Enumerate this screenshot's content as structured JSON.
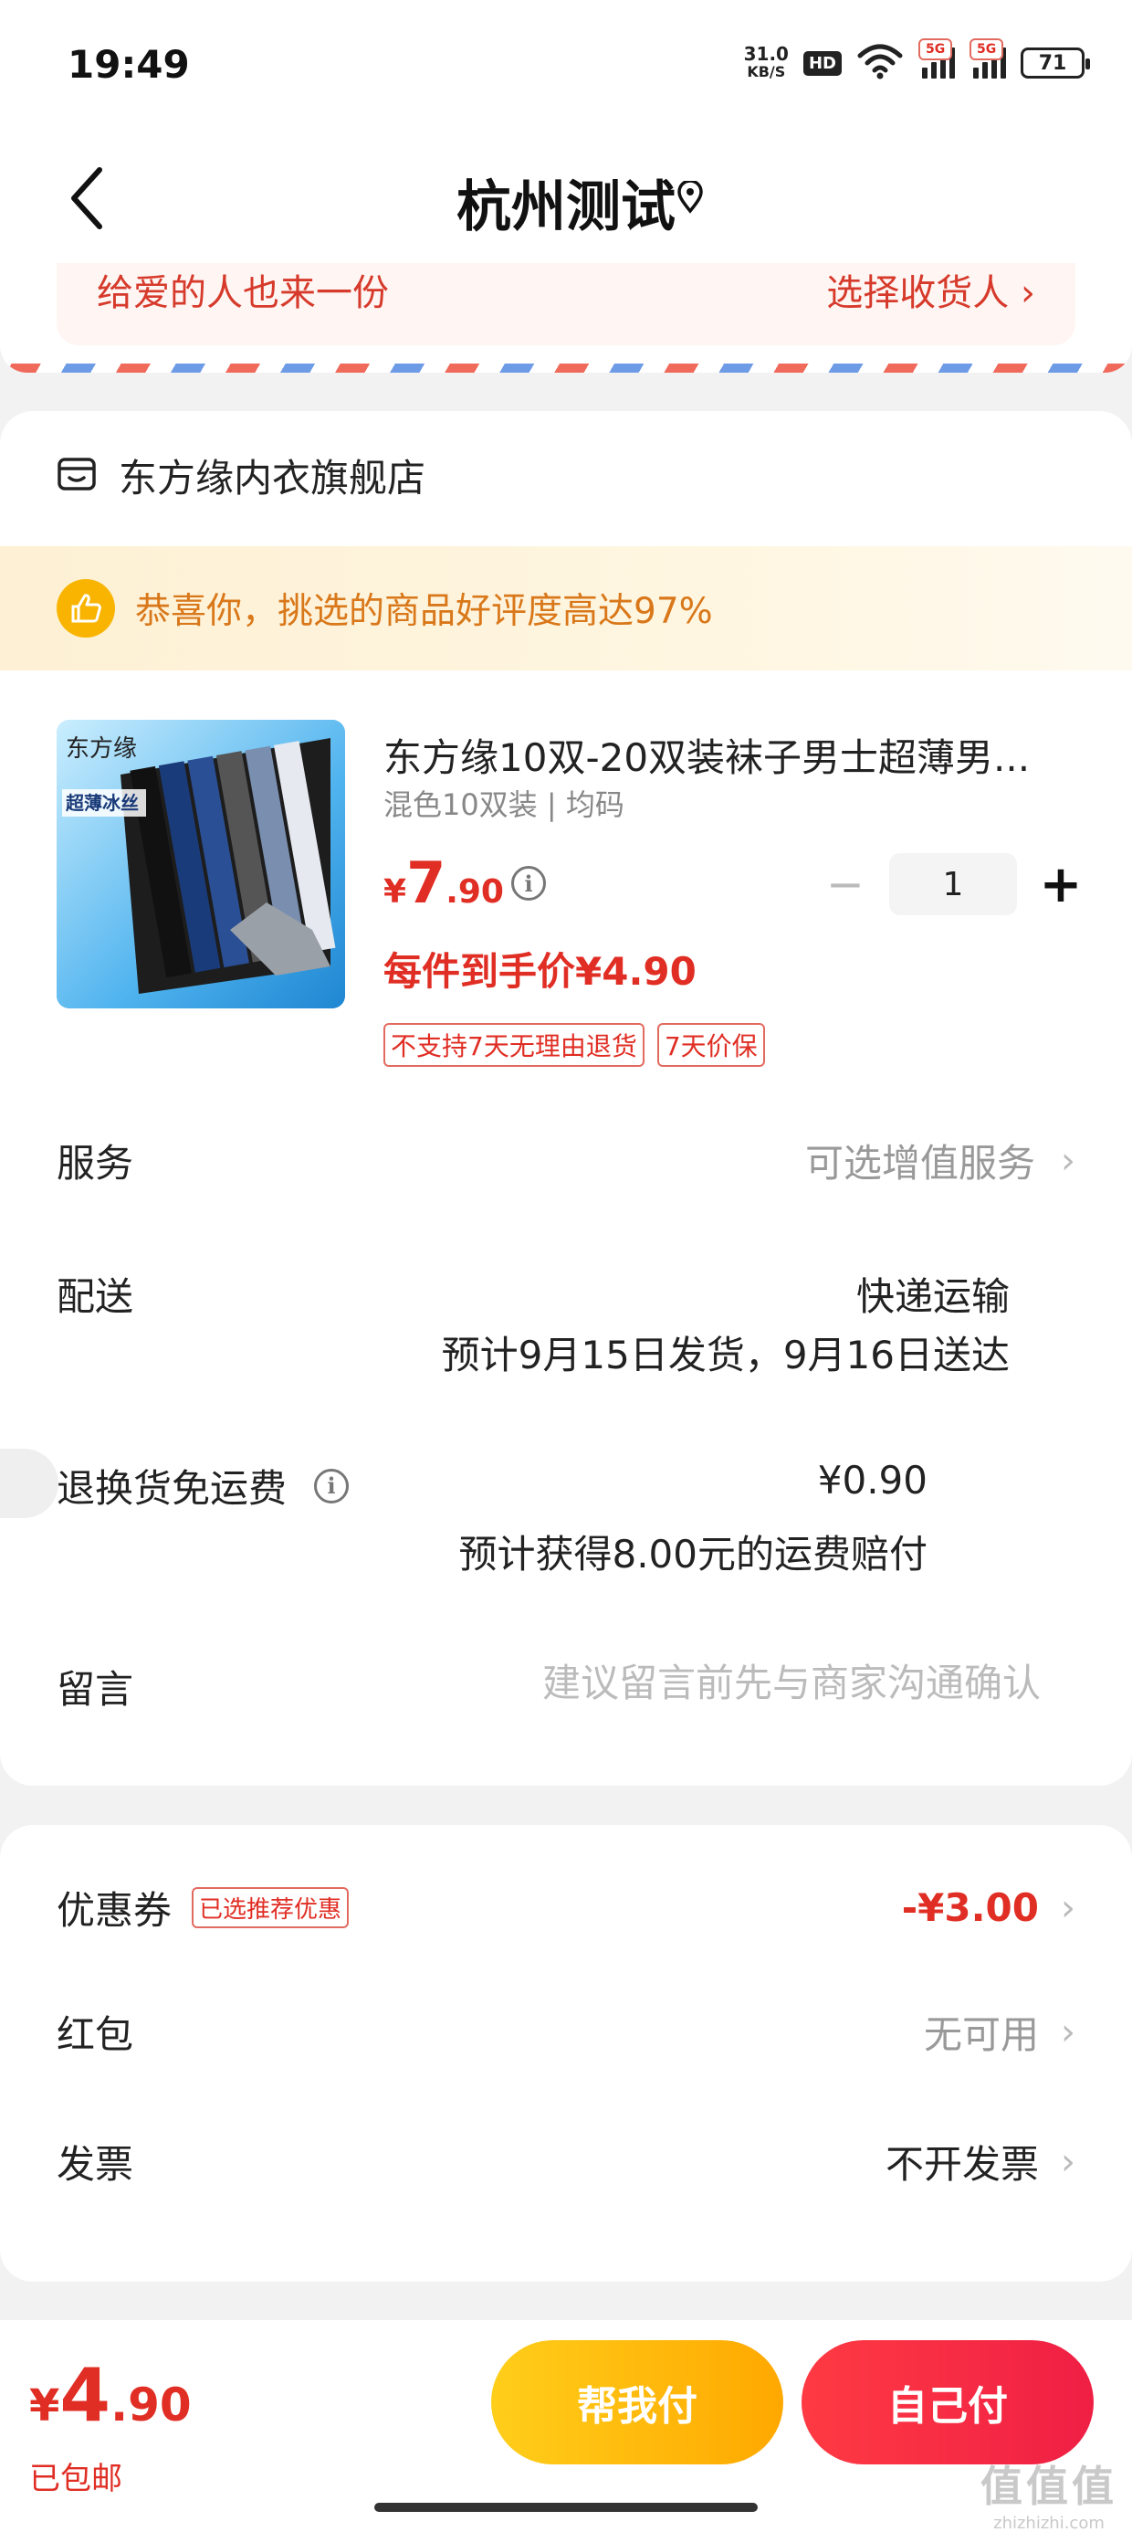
{
  "status_bar": {
    "time": "19:49",
    "net_speed": "31.0",
    "net_unit": "KB/S",
    "hd": "HD",
    "sig1": "5G",
    "sig2": "5G",
    "battery": "71"
  },
  "header": {
    "title": "杭州测试"
  },
  "address": {
    "left_text": "给爱的人也来一份",
    "right_text": "选择收货人 ›"
  },
  "store": {
    "name": "东方缘内衣旗舰店"
  },
  "praise": {
    "text": "恭喜你，挑选的商品好评度高达97%"
  },
  "product": {
    "title": "东方缘10双-20双装袜子男士超薄男...",
    "spec": "混色10双装 | 均码",
    "price_currency": "¥",
    "price_int": "7",
    "price_dec": ".90",
    "quantity": "1",
    "unit_price": "每件到手价¥4.90",
    "tags": [
      "不支持7天无理由退货",
      "7天价保"
    ],
    "image_brand": "东方缘",
    "image_label": "超薄冰丝"
  },
  "service": {
    "label": "服务",
    "value": "可选增值服务"
  },
  "delivery": {
    "label": "配送",
    "method": "快递运输",
    "schedule": "预计9月15日发货，9月16日送达"
  },
  "return_shipping": {
    "label": "退换货免运费",
    "price": "¥0.90",
    "compensation": "预计获得8.00元的运费赔付",
    "enabled": false
  },
  "message": {
    "label": "留言",
    "placeholder": "建议留言前先与商家沟通确认",
    "value": ""
  },
  "coupon": {
    "label": "优惠券",
    "tag": "已选推荐优惠",
    "value": "-¥3.00"
  },
  "red_packet": {
    "label": "红包",
    "value": "无可用"
  },
  "invoice": {
    "label": "发票",
    "value": "不开发票"
  },
  "footer": {
    "total_currency": "¥",
    "total_int": "4",
    "total_dec": ".90",
    "shipping": "已包邮",
    "help_pay": "帮我付",
    "self_pay": "自己付"
  },
  "watermark": {
    "big": "值值值",
    "small": "zhizhizhi.com"
  },
  "colors": {
    "accent_red": "#e02e24",
    "help_button": "#ffb400",
    "self_button": "#f1213f",
    "praise_text": "#d9781a"
  }
}
